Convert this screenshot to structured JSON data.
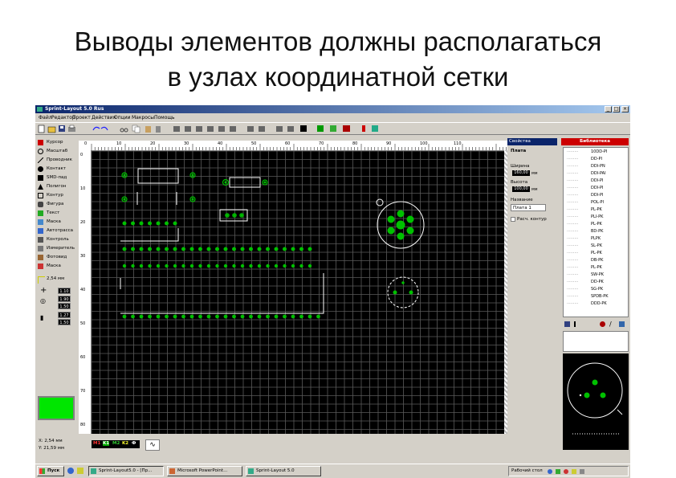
{
  "slide": {
    "title_line1": "Выводы элементов должны располагаться",
    "title_line2": "в узлах координатной сетки"
  },
  "window": {
    "title": "Sprint-Layout 5.0 Rus",
    "buttons": [
      "_",
      "□",
      "×"
    ]
  },
  "menu": [
    "Файл",
    "Редактор",
    "Проект",
    "Действия",
    "Опции",
    "Макросы",
    "Помощь"
  ],
  "tools": [
    {
      "label": "Курсор",
      "icon": "cursor-icon"
    },
    {
      "label": "Масштаб",
      "icon": "zoom-icon"
    },
    {
      "label": "Проводник",
      "icon": "track-icon"
    },
    {
      "label": "Контакт",
      "icon": "pad-icon"
    },
    {
      "label": "SMD-пад",
      "icon": "smd-pad-icon"
    },
    {
      "label": "Полигон",
      "icon": "polygon-icon"
    },
    {
      "label": "Контур",
      "icon": "outline-icon"
    },
    {
      "label": "Фигура",
      "icon": "shape-icon"
    },
    {
      "label": "Текст",
      "icon": "text-icon"
    },
    {
      "label": "Маска",
      "icon": "mask-icon"
    },
    {
      "label": "Автотрасса",
      "icon": "autoroute-icon"
    },
    {
      "label": "Контроль",
      "icon": "check-icon"
    },
    {
      "label": "Измеритель",
      "icon": "measure-icon"
    },
    {
      "label": "Фотовид",
      "icon": "photo-icon"
    },
    {
      "label": "Маска",
      "icon": "mask2-icon"
    }
  ],
  "grid_label": "2,54 мм",
  "widths": [
    "1.10",
    "1.90",
    "1.50",
    "1.27",
    "1.50"
  ],
  "rulers": {
    "h": [
      "0",
      "10",
      "20",
      "30",
      "40",
      "50",
      "60",
      "70",
      "80",
      "90",
      "100",
      "110"
    ],
    "v": [
      "0",
      "10",
      "20",
      "30",
      "40",
      "50",
      "60",
      "70",
      "80"
    ]
  },
  "properties": {
    "header": "Свойства",
    "section": "Плата",
    "width_label": "Ширина",
    "width_value": "160,00",
    "height_label": "Высота",
    "height_value": "100,00",
    "unit": "мм",
    "name_label": "Название",
    "name_value": "Плата 1",
    "checkbox_label": "Расч. контур"
  },
  "library": {
    "header": "Библиотека",
    "items": [
      "10DD-PI",
      "DD-PI",
      "DDI-PN",
      "DDI-PAI",
      "DDI-PI",
      "DDI-PI",
      "DDI-PI",
      "POL-PI",
      "PL-PK",
      "PLI-PK",
      "PL-PK",
      "BD-PK",
      "PLPK",
      "SL-PK",
      "PL-PK",
      "DB-PK",
      "PL-PK",
      "SW-PK",
      "DD-PK",
      "SG-PK",
      "SPDB-PK",
      "DDD-PK"
    ]
  },
  "status": {
    "line1": "Х: 2,54 мм",
    "line2": "Y: 21,59 мм",
    "layers": [
      "M1",
      "K1",
      "M2",
      "K2",
      "Ф"
    ]
  },
  "taskbar": {
    "start": "Пуск",
    "tasks": [
      "Sprint-Layout5.0 - [Пр...",
      "Microsoft PowerPoint...",
      "Sprint-Layout 5.0"
    ],
    "tray_text": "Рабочий стол",
    "clock": ""
  },
  "colors": {
    "canvas": "#000000",
    "grid": "#5a5a5a",
    "pad": "#00c000",
    "silk": "#ffffff",
    "swatch": "#00e600"
  }
}
